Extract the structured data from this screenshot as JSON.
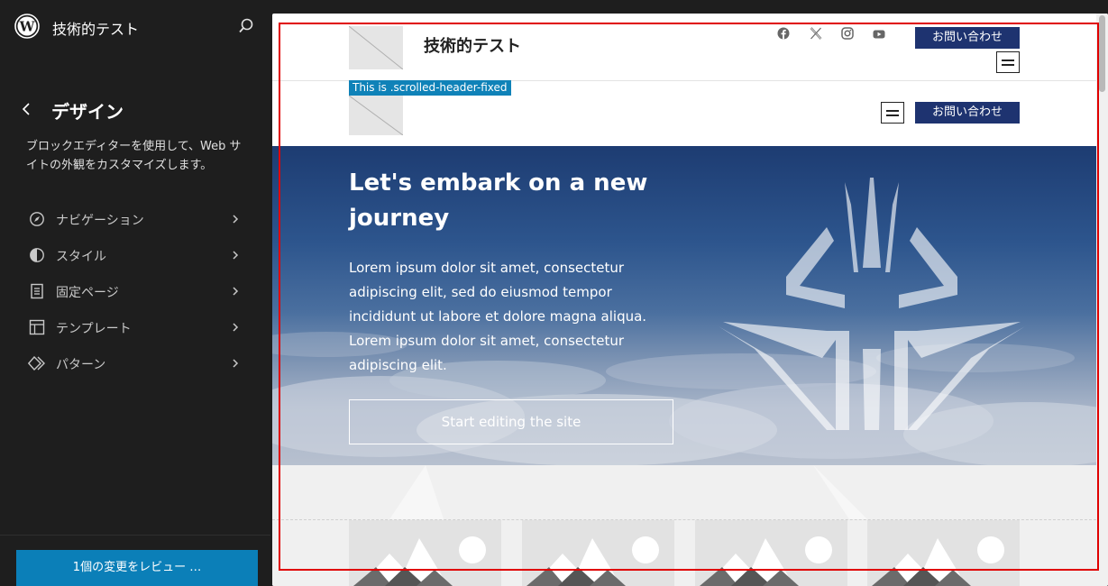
{
  "sidebar": {
    "site_name": "技術的テスト",
    "title": "デザイン",
    "description": "ブロックエディターを使用して、Web サイトの外観をカスタマイズします。",
    "nav": [
      {
        "label": "ナビゲーション",
        "icon": "navigation-icon"
      },
      {
        "label": "スタイル",
        "icon": "styles-icon"
      },
      {
        "label": "固定ページ",
        "icon": "page-icon"
      },
      {
        "label": "テンプレート",
        "icon": "template-icon"
      },
      {
        "label": "パターン",
        "icon": "pattern-icon"
      }
    ],
    "review_button": "1個の変更をレビュー …"
  },
  "preview": {
    "header": {
      "site_title": "技術的テスト",
      "contact_label": "お問い合わせ",
      "social_icons": [
        "facebook-icon",
        "x-icon",
        "instagram-icon",
        "youtube-icon"
      ]
    },
    "fixed_header": {
      "tag": "This is .scrolled-header-fixed",
      "contact_label": "お問い合わせ"
    },
    "hero": {
      "title": "Let's embark on a new journey",
      "text": "Lorem ipsum dolor sit amet, consectetur adipiscing elit, sed do eiusmod tempor incididunt ut labore et dolore magna aliqua. Lorem ipsum dolor sit amet, consectetur adipiscing elit.",
      "button": "Start editing the site"
    },
    "cards": 4
  },
  "colors": {
    "sidebar_bg": "#1e1e1e",
    "accent": "#0b7fb8",
    "contact_button": "#1e3370",
    "selection_outline": "#e00000",
    "fixed_tag": "#0f82b8"
  }
}
